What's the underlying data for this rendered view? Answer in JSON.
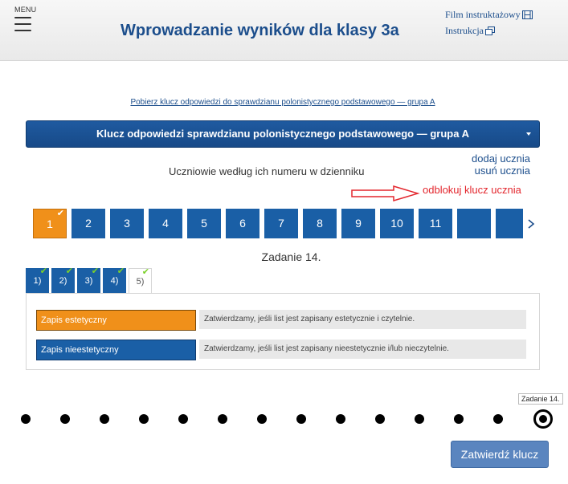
{
  "header": {
    "menu_label": "MENU",
    "title": "Wprowadzanie wyników dla klasy 3a",
    "links": [
      {
        "label": "Film instruktażowy",
        "icon": "film-icon"
      },
      {
        "label": "Instrukcja",
        "icon": "copy-icon"
      }
    ]
  },
  "download_link": "Pobierz klucz odpowiedzi do sprawdzianu polonistycznego podstawowego — grupa A",
  "key_select": {
    "value": "Klucz odpowiedzi sprawdzianu polonistycznego podstawowego — grupa A"
  },
  "students": {
    "label": "Uczniowie według ich numeru w dzienniku",
    "add_link": "dodaj ucznia",
    "remove_link": "usuń ucznia",
    "unlock_link": "odblokuj klucz ucznia",
    "numbers": [
      "1",
      "2",
      "3",
      "4",
      "5",
      "6",
      "7",
      "8",
      "9",
      "10",
      "11",
      "",
      ""
    ],
    "active_index": 0,
    "checkmark": "✔",
    "next_icon": "chevron-right-icon"
  },
  "task": {
    "label": "Zadanie 14.",
    "tabs": [
      "1)",
      "2)",
      "3)",
      "4)",
      "5)"
    ],
    "active_tab": 4,
    "options": [
      {
        "label": "Zapis estetyczny",
        "description": "Zatwierdzamy, jeśli list jest zapisany estetycznie i czytelnie.",
        "color": "#f0901a"
      },
      {
        "label": "Zapis nieestetyczny",
        "description": "Zatwierdzamy, jeśli list jest zapisany nieestetycznie i/lub nieczytelnie.",
        "color": "#1a5fa6"
      }
    ]
  },
  "timeline": {
    "tooltip": "Zadanie 14.",
    "dot_count": 14,
    "current_index": 13
  },
  "confirm_button": "Zatwierdź klucz",
  "colors": {
    "accent": "#1a5fa6",
    "orange": "#f0901a",
    "red": "#e3262d"
  }
}
